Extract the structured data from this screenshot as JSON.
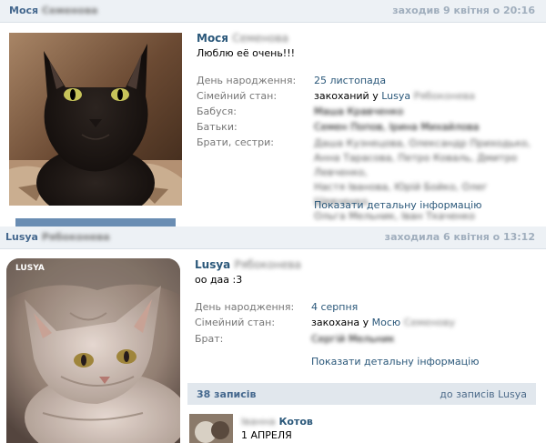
{
  "profile1": {
    "header_name": "Мося",
    "header_name_hidden": "Семенова",
    "last_seen": "заходив 9 квітня о 20:16",
    "name": "Мося",
    "name_hidden": "Семенова",
    "status": "Люблю её очень!!!",
    "birthday_label": "День народження:",
    "birthday_value": "25 листопада",
    "family_label": "Сімейний стан:",
    "family_value": "закоханий у",
    "family_person": "Lusya",
    "family_person_hidden": "Рябоконева",
    "grandma_label": "Бабуся:",
    "grandma_hidden": "Маша Кравченко",
    "parents_label": "Батьки:",
    "parents_hidden": "Семен Попов, Ірина Михайлова",
    "siblings_label": "Брати, сестри:",
    "siblings_hidden": [
      "Даша Кузнецова, Олександр Приходько,",
      "Анна Тарасова, Петро Коваль, Дмитро Левченко,",
      "Настя Іванова, Юрій Бойко, Олег Шевченко,",
      "Ольга Мельник, Іван Ткаченко"
    ],
    "more_info": "Показати детальну інформацію"
  },
  "profile2": {
    "header_name": "Lusya",
    "header_name_hidden": "Рябоконева",
    "last_seen": "заходила 6 квітня о 13:12",
    "photo_tag": "LUSYA",
    "name": "Lusya",
    "name_hidden": "Рябоконева",
    "status": "оо даа :3",
    "birthday_label": "День народження:",
    "birthday_value": "4 серпня",
    "family_label": "Сімейний стан:",
    "family_value": "закохана у",
    "family_person": "Мосю",
    "family_person_hidden": "Семенову",
    "brother_label": "Брат:",
    "brother_hidden": "Сергій Мельник",
    "more_info": "Показати детальну інформацію",
    "wall_count": "38 записів",
    "wall_link": "до записів Lusya",
    "post_author_hidden": "Іванна",
    "post_author": "Котов",
    "post_text": "1 АПРЕЛЯ"
  },
  "colors": {
    "header_bg": "#edf1f5",
    "link": "#2b587a",
    "seen": "#a0aebd",
    "wall_bar": "#e1e7ed"
  }
}
